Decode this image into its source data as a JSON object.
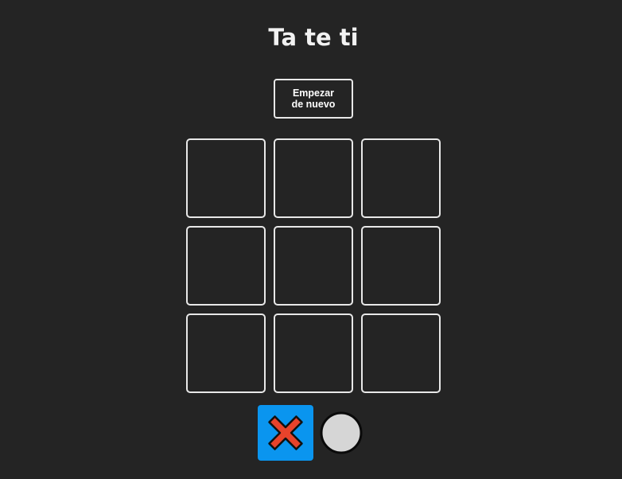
{
  "game": {
    "title": "Ta te ti",
    "reset_label": "Empezar de nuevo",
    "board": [
      "",
      "",
      "",
      "",
      "",
      "",
      "",
      "",
      ""
    ],
    "current_turn": "x",
    "players": [
      {
        "symbol": "x",
        "icon": "x-mark-icon",
        "color": "#e8432b",
        "active": true
      },
      {
        "symbol": "o",
        "icon": "circle-icon",
        "color": "#d6d6d6",
        "active": false
      }
    ]
  },
  "colors": {
    "background": "#242424",
    "border": "#e8e8e8",
    "active_turn": "#0a95ef",
    "x_mark": "#e8432b",
    "o_mark": "#d6d6d6"
  }
}
